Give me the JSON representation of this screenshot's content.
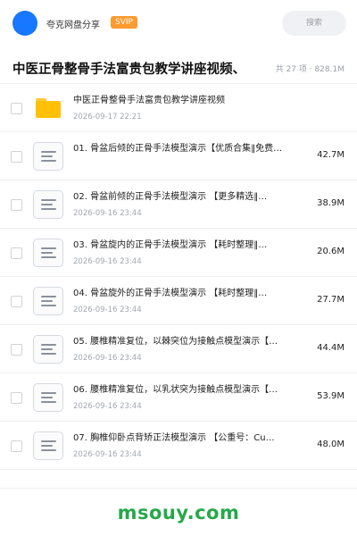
{
  "header": {
    "username": "夸克网盘分享",
    "vip_badge": "SVIP",
    "search_placeholder": "搜索"
  },
  "page": {
    "title": "中医正骨整骨手法富贵包教学讲座视频、",
    "summary": "共 27 项 · 828.1M"
  },
  "files": [
    {
      "type": "folder",
      "name": "中医正骨整骨手法富贵包教学讲座视频",
      "date": "2026-09-17 22:21",
      "size": ""
    },
    {
      "type": "file",
      "name": "01. 骨盆后倾的正骨手法模型演示【优质合集‖免费…",
      "date": "",
      "size": "42.7M"
    },
    {
      "type": "file",
      "name": "02. 骨盆前倾的正骨手法模型演示 【更多精选‖…",
      "date": "2026-09-16 23:44",
      "size": "38.9M"
    },
    {
      "type": "file",
      "name": "03. 骨盆旋内的正骨手法模型演示 【耗时整理‖…",
      "date": "2026-09-16 23:44",
      "size": "20.6M"
    },
    {
      "type": "file",
      "name": "04. 骨盆旋外的正骨手法模型演示 【耗时整理‖…",
      "date": "2026-09-16 23:44",
      "size": "27.7M"
    },
    {
      "type": "file",
      "name": "05. 腰椎精准复位，以棘突位为接触点模型演示【…",
      "date": "2026-09-16 23:44",
      "size": "44.4M"
    },
    {
      "type": "file",
      "name": "06. 腰椎精准复位，以乳状突为接触点模型演示【…",
      "date": "2026-09-16 23:44",
      "size": "53.9M"
    },
    {
      "type": "file",
      "name": "07. 胸椎仰卧点背矫正法模型演示 【公重号：Cu…",
      "date": "2026-09-16 23:44",
      "size": "48.0M"
    }
  ],
  "watermark": "msouy.com",
  "colors": {
    "accent": "#1677ff",
    "vip": "#ff9a2e",
    "folder": "#ffc107",
    "watermark": "#26a84a"
  }
}
